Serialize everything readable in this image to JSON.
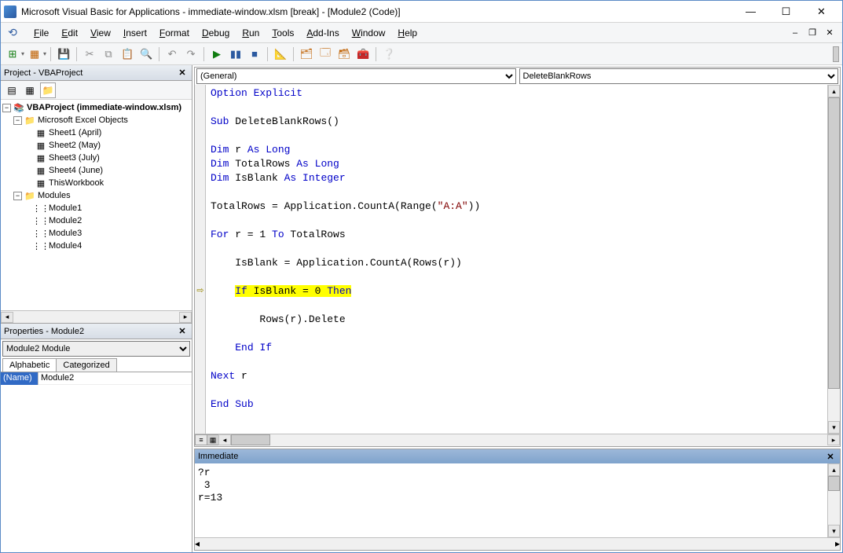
{
  "title": "Microsoft Visual Basic for Applications - immediate-window.xlsm [break] - [Module2 (Code)]",
  "menus": [
    "File",
    "Edit",
    "View",
    "Insert",
    "Format",
    "Debug",
    "Run",
    "Tools",
    "Add-Ins",
    "Window",
    "Help"
  ],
  "project_panel": {
    "title": "Project - VBAProject",
    "root": "VBAProject (immediate-window.xlsm)",
    "excel_objects_label": "Microsoft Excel Objects",
    "sheets": [
      "Sheet1 (April)",
      "Sheet2 (May)",
      "Sheet3 (July)",
      "Sheet4 (June)",
      "ThisWorkbook"
    ],
    "modules_label": "Modules",
    "modules": [
      "Module1",
      "Module2",
      "Module3",
      "Module4"
    ]
  },
  "properties_panel": {
    "title": "Properties - Module2",
    "combo": "Module2 Module",
    "tabs": [
      "Alphabetic",
      "Categorized"
    ],
    "prop_name_label": "(Name)",
    "prop_name_value": "Module2"
  },
  "code": {
    "left_combo": "(General)",
    "right_combo": "DeleteBlankRows",
    "lines": [
      {
        "t": "Option Explicit",
        "k": [
          "Option",
          "Explicit"
        ]
      },
      {
        "t": ""
      },
      {
        "t": "Sub DeleteBlankRows()",
        "k": [
          "Sub"
        ]
      },
      {
        "t": ""
      },
      {
        "t": "Dim r As Long",
        "k": [
          "Dim",
          "As",
          "Long"
        ]
      },
      {
        "t": "Dim TotalRows As Long",
        "k": [
          "Dim",
          "As",
          "Long"
        ]
      },
      {
        "t": "Dim IsBlank As Integer",
        "k": [
          "Dim",
          "As",
          "Integer"
        ]
      },
      {
        "t": ""
      },
      {
        "t": "TotalRows = Application.CountA(Range(\"A:A\"))",
        "s": [
          "\"A:A\""
        ]
      },
      {
        "t": ""
      },
      {
        "t": "For r = 1 To TotalRows",
        "k": [
          "For",
          "To"
        ]
      },
      {
        "t": ""
      },
      {
        "t": "    IsBlank = Application.CountA(Rows(r))"
      },
      {
        "t": ""
      },
      {
        "t": "    If IsBlank = 0 Then",
        "k": [
          "If",
          "Then"
        ],
        "hl": true,
        "break": true
      },
      {
        "t": ""
      },
      {
        "t": "        Rows(r).Delete"
      },
      {
        "t": ""
      },
      {
        "t": "    End If",
        "k": [
          "End",
          "If"
        ]
      },
      {
        "t": ""
      },
      {
        "t": "Next r",
        "k": [
          "Next"
        ]
      },
      {
        "t": ""
      },
      {
        "t": "End Sub",
        "k": [
          "End",
          "Sub"
        ]
      }
    ]
  },
  "immediate": {
    "title": "Immediate",
    "content": "?r\n 3\nr=13\n"
  }
}
